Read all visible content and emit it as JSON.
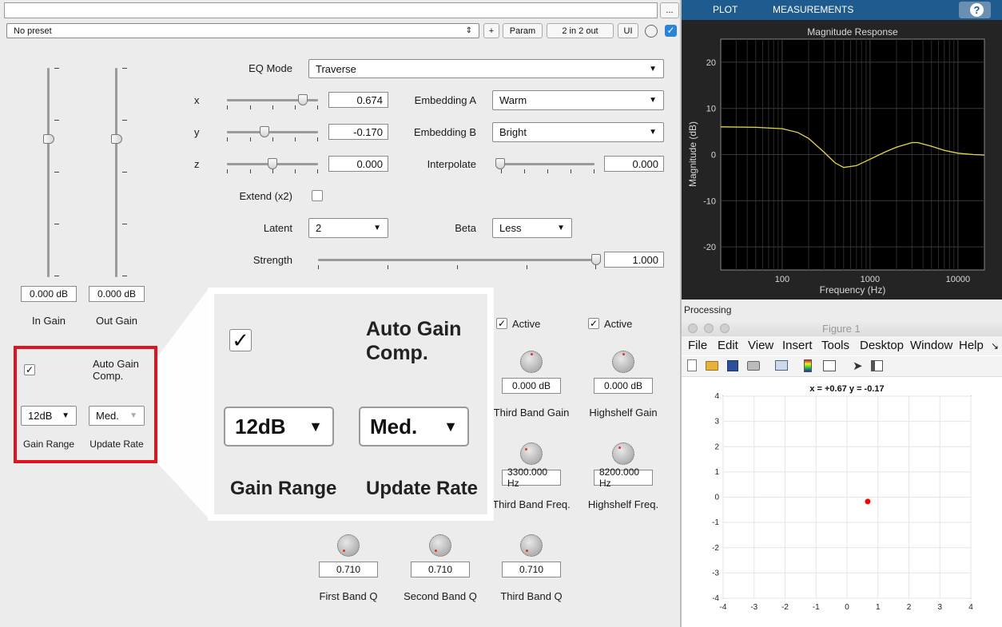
{
  "plugin": {
    "preset_select": "No preset",
    "more_button": "...",
    "plus_button": "+",
    "param_button": "Param",
    "io_button": "2 in 2 out",
    "ui_button": "UI",
    "gains": {
      "in_value": "0.000 dB",
      "out_value": "0.000 dB",
      "in_label": "In Gain",
      "out_label": "Out Gain"
    },
    "eq_mode": {
      "label": "EQ Mode",
      "value": "Traverse"
    },
    "x": {
      "label": "x",
      "value": "0.674",
      "slider": 0.674
    },
    "y": {
      "label": "y",
      "value": "-0.170",
      "slider": -0.17
    },
    "z": {
      "label": "z",
      "value": "0.000",
      "slider": 0.0
    },
    "embedding_a": {
      "label": "Embedding A",
      "value": "Warm"
    },
    "embedding_b": {
      "label": "Embedding B",
      "value": "Bright"
    },
    "interpolate": {
      "label": "Interpolate",
      "value": "0.000",
      "slider": 0.0
    },
    "extend": {
      "label": "Extend (x2)",
      "checked": false
    },
    "latent": {
      "label": "Latent",
      "value": "2"
    },
    "beta": {
      "label": "Beta",
      "value": "Less"
    },
    "strength": {
      "label": "Strength",
      "value": "1.000",
      "slider": 1.0
    },
    "auto_gain": {
      "checked": true,
      "check_glyph": "✓",
      "label_line1": "Auto Gain",
      "label_line2": "Comp.",
      "gain_range": "12dB",
      "update_rate": "Med.",
      "gain_range_label": "Gain Range",
      "update_rate_label": "Update Rate"
    },
    "third_band": {
      "active_label": "Active",
      "active_checked": true,
      "gain_value": "0.000 dB",
      "gain_label": "Third Band Gain",
      "freq_value": "3300.000 Hz",
      "freq_label": "Third Band Freq.",
      "q_value": "0.710",
      "q_label": "Third Band Q"
    },
    "highshelf": {
      "active_label": "Active",
      "active_checked": true,
      "gain_value": "0.000 dB",
      "gain_label": "Highshelf Gain",
      "freq_value": "8200.000 Hz",
      "freq_label": "Highshelf Freq."
    },
    "first_band": {
      "q_value": "0.710",
      "q_label": "First Band Q"
    },
    "second_band": {
      "q_value": "0.710",
      "q_label": "Second Band Q"
    }
  },
  "analyzer": {
    "tabs": [
      "PLOT",
      "MEASUREMENTS"
    ],
    "help_icon": "?",
    "processing_label": "Processing",
    "figure_title": "Figure 1",
    "menu": [
      "File",
      "Edit",
      "View",
      "Insert",
      "Tools",
      "Desktop",
      "Window",
      "Help"
    ],
    "toolbar_icons": [
      "new-file-icon",
      "open-folder-icon",
      "save-icon",
      "print-icon",
      "link-icon",
      "colorbar-icon",
      "legend-icon",
      "pointer-icon",
      "panel-icon"
    ],
    "xy_title": "x = +0.67 y = -0.17"
  },
  "chart_data": [
    {
      "type": "line",
      "title": "Magnitude Response",
      "xlabel": "Frequency (Hz)",
      "ylabel": "Magnitude (dB)",
      "xscale": "log",
      "xlim": [
        20,
        20000
      ],
      "ylim": [
        -25,
        25
      ],
      "xticks": [
        100,
        1000,
        10000
      ],
      "xtick_labels": [
        "100",
        "1000",
        "10000"
      ],
      "yticks": [
        -20,
        -10,
        0,
        10,
        20
      ],
      "grid": true,
      "background": "#000000",
      "line_color": "#e6d84a",
      "x": [
        20,
        50,
        100,
        150,
        200,
        300,
        400,
        500,
        700,
        1000,
        1500,
        2000,
        3000,
        3500,
        5000,
        7000,
        10000,
        15000,
        20000
      ],
      "y": [
        6.0,
        5.9,
        5.6,
        4.8,
        3.5,
        0.5,
        -1.8,
        -2.8,
        -2.4,
        -1.0,
        0.6,
        1.6,
        2.6,
        2.6,
        1.8,
        0.9,
        0.3,
        0.0,
        -0.1
      ]
    },
    {
      "type": "scatter",
      "title": "x = +0.67 y = -0.17",
      "xlim": [
        -4,
        4
      ],
      "ylim": [
        -4,
        4
      ],
      "xticks": [
        -4,
        -3,
        -2,
        -1,
        0,
        1,
        2,
        3,
        4
      ],
      "yticks": [
        -4,
        -3,
        -2,
        -1,
        0,
        1,
        2,
        3,
        4
      ],
      "grid": true,
      "point_color": "#ff0000",
      "x": [
        0.67
      ],
      "y": [
        -0.17
      ]
    }
  ]
}
